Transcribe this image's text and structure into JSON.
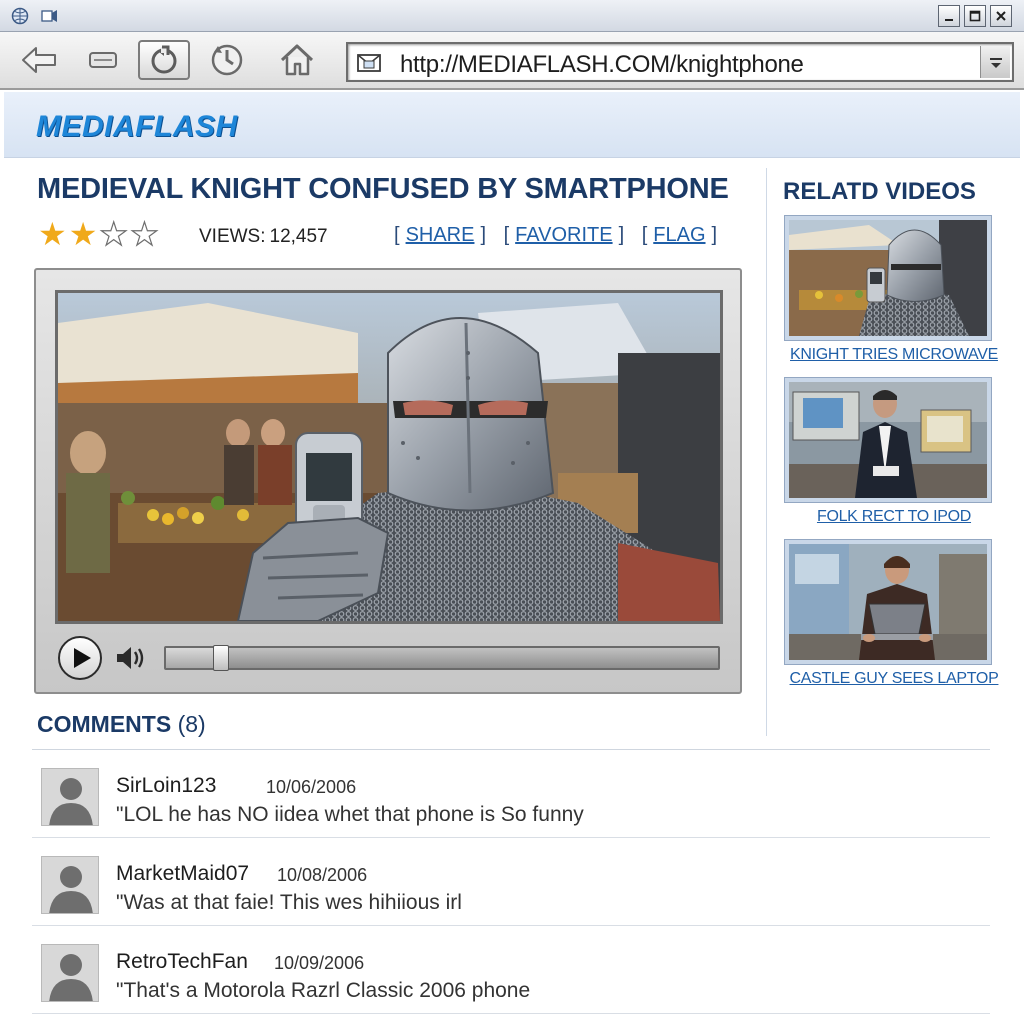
{
  "browser": {
    "address_url": "http://MEDIAFLASH.COM/knightphone"
  },
  "site": {
    "logo": "MEDIAFLASH"
  },
  "video": {
    "title": "MEDIEVAL KNIGHT CONFUSED BY SMARTPHONE",
    "rating": 2,
    "rating_max": 4,
    "views_label": "VIEWS:",
    "views_count": "12,457",
    "actions": [
      "SHARE",
      "FAVORITE",
      "FLAG"
    ],
    "progress_fraction": 0.1
  },
  "sidebar": {
    "title": "RELATD VIDEOS",
    "items": [
      {
        "label": "KNIGHT TRIES MICROWAVE"
      },
      {
        "label": "FOLK RECT TO IPOD"
      },
      {
        "label": "CASTLE GUY SEES LAPTOP"
      }
    ]
  },
  "comments": {
    "title": "COMMENTS",
    "count": "(8)",
    "items": [
      {
        "user": "SirLoin123",
        "date": "10/06/2006",
        "text": "\"LOL he has NO iidea whet that phone is So funny"
      },
      {
        "user": "MarketMaid07",
        "date": "10/08/2006",
        "text": "\"Was at that faie! This wes hihiious irl"
      },
      {
        "user": "RetroTechFan",
        "date": "10/09/2006",
        "text": "\"That's a Motorola Razrl Classic 2006 phone"
      }
    ]
  },
  "colors": {
    "logo": "#1e86d8",
    "title": "#1b3a66",
    "link": "#1f5fa8",
    "star_on": "#f0a91a"
  }
}
